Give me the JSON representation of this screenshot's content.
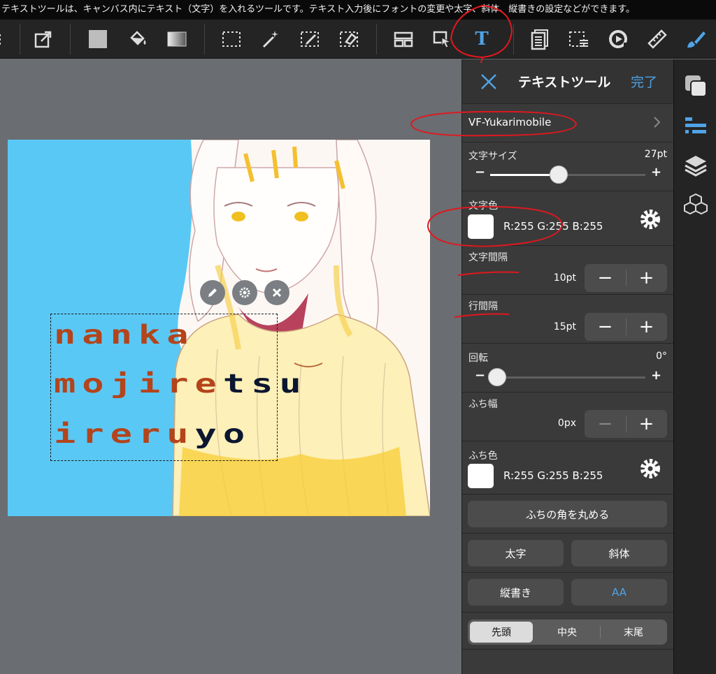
{
  "caption": "テキストツールは、キャンバス内にテキスト（文字）を入れるツールです。テキスト入力後にフォントの変更や太字、斜体、縦書きの設定などができます。",
  "colors": {
    "accent": "#4fa3e6",
    "canvas_bg": "#5ac8f5",
    "annotation": "#e0181f",
    "text_orange": "#b3441b",
    "text_dark": "#0b1630"
  },
  "toolbar": {
    "icons": [
      "menu-icon",
      "export-icon",
      "fill-color-icon",
      "bucket-icon",
      "gradient-icon",
      "select-rect-icon",
      "magic-wand-icon",
      "select-pen-icon",
      "select-eraser-icon",
      "layout-icon",
      "move-icon",
      "text-tool-icon",
      "pages-icon",
      "transform-icon",
      "rotate-icon",
      "ruler-icon",
      "brush-icon"
    ],
    "text_tool_glyph": "T"
  },
  "canvas": {
    "text_lines": [
      {
        "main": "nanka",
        "dark": ""
      },
      {
        "main": "mojire",
        "dark": "tsu"
      },
      {
        "main": "ireru",
        "dark": "yo"
      }
    ]
  },
  "panel": {
    "title": "テキストツール",
    "done": "完了",
    "font_name": "VF-Yukarimobile",
    "font_size": {
      "label": "文字サイズ",
      "value": "27pt",
      "level": 0.44
    },
    "text_color": {
      "label": "文字色",
      "rgb": "R:255 G:255 B:255",
      "swatch": "#ffffff"
    },
    "letter_spacing": {
      "label": "文字間隔",
      "value": "10pt"
    },
    "line_spacing": {
      "label": "行間隔",
      "value": "15pt"
    },
    "rotation": {
      "label": "回転",
      "value": "0°",
      "level": 0.0
    },
    "stroke_width": {
      "label": "ふち幅",
      "value": "0px"
    },
    "stroke_color": {
      "label": "ふち色",
      "rgb": "R:255 G:255 B:255",
      "swatch": "#ffffff"
    },
    "round_corners": "ふちの角を丸める",
    "bold": "太字",
    "italic": "斜体",
    "vertical": "縦書き",
    "antialias": "AA",
    "align": {
      "options": [
        "先頭",
        "中央",
        "末尾"
      ],
      "selected": "先頭"
    },
    "minus": "−",
    "plus": "+"
  },
  "strip": {
    "icons": [
      "color-icon",
      "layer-list-icon",
      "layers-icon",
      "materials-icon"
    ]
  }
}
